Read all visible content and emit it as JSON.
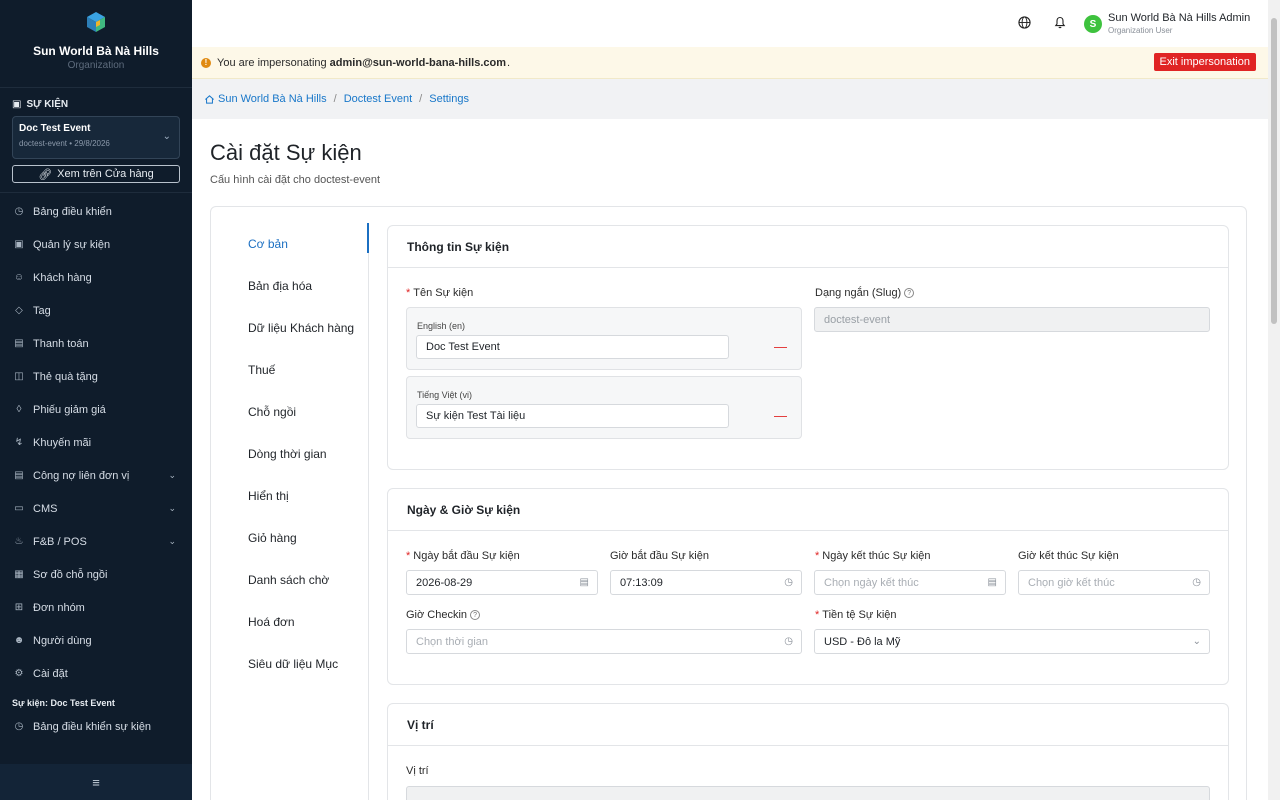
{
  "sidebar": {
    "org_name": "Sun World Bà Nà Hills",
    "org_sub": "Organization",
    "section_label": "SỰ KIỆN",
    "event": {
      "name": "Doc Test Event",
      "sub": "doctest-event • 29/8/2026"
    },
    "store_button": "Xem trên Cửa hàng",
    "items": [
      {
        "label": "Bảng điều khiển",
        "icon": "dashboard-icon"
      },
      {
        "label": "Quản lý sự kiện",
        "icon": "calendar-icon"
      },
      {
        "label": "Khách hàng",
        "icon": "users-icon"
      },
      {
        "label": "Tag",
        "icon": "tag-icon"
      },
      {
        "label": "Thanh toán",
        "icon": "payment-icon"
      },
      {
        "label": "Thẻ quà tặng",
        "icon": "gift-icon"
      },
      {
        "label": "Phiếu giảm giá",
        "icon": "coupon-icon"
      },
      {
        "label": "Khuyến mãi",
        "icon": "bolt-icon"
      },
      {
        "label": "Công nợ liên đơn vị",
        "icon": "ledger-icon"
      },
      {
        "label": "CMS",
        "icon": "cms-icon"
      },
      {
        "label": "F&B / POS",
        "icon": "food-icon"
      },
      {
        "label": "Sơ đồ chỗ ngồi",
        "icon": "seatmap-icon"
      },
      {
        "label": "Đơn nhóm",
        "icon": "grid-icon"
      },
      {
        "label": "Người dùng",
        "icon": "user-icon"
      },
      {
        "label": "Cài đặt",
        "icon": "gear-icon"
      }
    ],
    "event_section_label": "Sự kiện: Doc Test Event",
    "event_items": [
      {
        "label": "Bảng điều khiển sự kiện",
        "icon": "dashboard-icon"
      }
    ]
  },
  "header": {
    "user_name": "Sun World Bà Nà Hills Admin",
    "user_role": "Organization User",
    "avatar_letter": "S"
  },
  "banner": {
    "prefix": "You are impersonating",
    "email": "admin@sun-world-bana-hills.com",
    "suffix": ".",
    "exit_label": "Exit impersonation"
  },
  "breadcrumb": [
    "Sun World Bà Nà Hills",
    "Doctest Event",
    "Settings"
  ],
  "page": {
    "title": "Cài đặt Sự kiện",
    "subtitle": "Cấu hình cài đặt cho doctest-event"
  },
  "tabs": [
    "Cơ bản",
    "Bản địa hóa",
    "Dữ liệu Khách hàng",
    "Thuế",
    "Chỗ ngồi",
    "Dòng thời gian",
    "Hiển thị",
    "Giỏ hàng",
    "Danh sách chờ",
    "Hoá đơn",
    "Siêu dữ liệu Mục"
  ],
  "info_panel": {
    "title": "Thông tin Sự kiện",
    "name_label": "Tên Sự kiện",
    "slug_label": "Dạng ngắn (Slug)",
    "slug_value": "doctest-event",
    "langs": [
      {
        "label": "English (en)",
        "value": "Doc Test Event"
      },
      {
        "label": "Tiếng Việt (vi)",
        "value": "Sự kiện Test Tài liệu"
      }
    ]
  },
  "date_panel": {
    "title": "Ngày & Giờ Sự kiện",
    "start_date_label": "Ngày bắt đầu Sự kiện",
    "start_date_value": "2026-08-29",
    "start_time_label": "Giờ bắt đầu Sự kiện",
    "start_time_value": "07:13:09",
    "end_date_label": "Ngày kết thúc Sự kiện",
    "end_date_placeholder": "Chọn ngày kết thúc",
    "end_time_label": "Giờ kết thúc Sự kiện",
    "end_time_placeholder": "Chọn giờ kết thúc",
    "checkin_label": "Giờ Checkin",
    "checkin_placeholder": "Chọn thời gian",
    "currency_label": "Tiền tệ Sự kiện",
    "currency_value": "USD - Đô la Mỹ"
  },
  "location_panel": {
    "title": "Vị trí",
    "location_label": "Vị trí"
  }
}
